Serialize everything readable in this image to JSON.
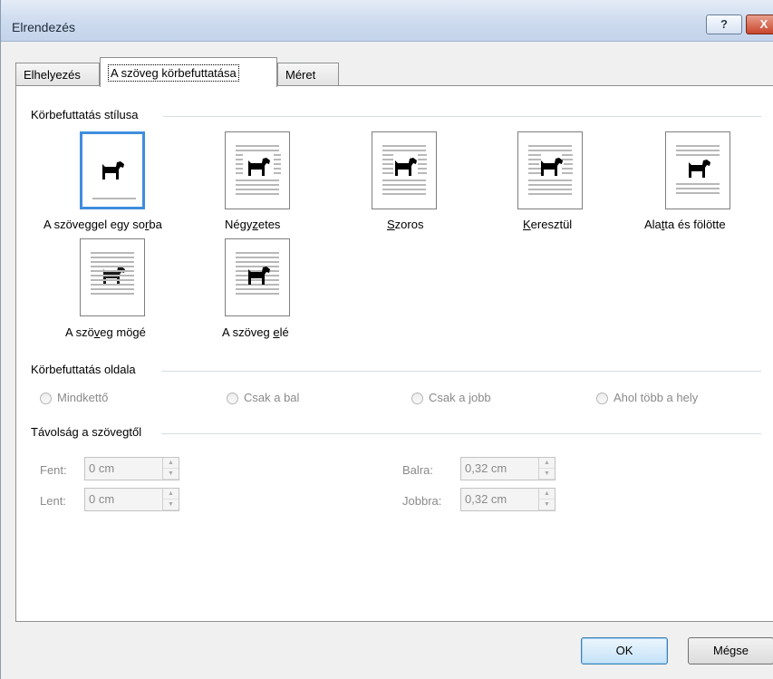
{
  "window": {
    "title": "Elrendezés",
    "help_label": "?",
    "close_label": "X"
  },
  "tabs": [
    {
      "label": "Elhelyezés",
      "active": false
    },
    {
      "label": "A szöveg körbefuttatása",
      "active": true
    },
    {
      "label": "Méret",
      "active": false
    }
  ],
  "wrap_style": {
    "title": "Körbefuttatás stílusa",
    "options": [
      {
        "label_pre": "A szöveggel egy so",
        "label_key": "r",
        "label_post": "ba",
        "icon": "inline-with-text-icon",
        "selected": true
      },
      {
        "label_pre": "Négy",
        "label_key": "z",
        "label_post": "etes",
        "icon": "square-wrap-icon",
        "selected": false
      },
      {
        "label_pre": "",
        "label_key": "S",
        "label_post": "zoros",
        "icon": "tight-wrap-icon",
        "selected": false
      },
      {
        "label_pre": "",
        "label_key": "K",
        "label_post": "eresztül",
        "icon": "through-wrap-icon",
        "selected": false
      },
      {
        "label_pre": "Ala",
        "label_key": "t",
        "label_post": "ta és fölötte",
        "icon": "top-bottom-wrap-icon",
        "selected": false
      },
      {
        "label_pre": "A szö",
        "label_key": "v",
        "label_post": "eg mögé",
        "icon": "behind-text-icon",
        "selected": false
      },
      {
        "label_pre": "A szöveg ",
        "label_key": "e",
        "label_post": "lé",
        "icon": "in-front-of-text-icon",
        "selected": false
      }
    ]
  },
  "wrap_side": {
    "title": "Körbefuttatás oldala",
    "options": [
      "Mindkettő",
      "Csak a bal",
      "Csak a jobb",
      "Ahol több a hely"
    ]
  },
  "distance": {
    "title": "Távolság a szövegtől",
    "top_label": "Fent:",
    "top_value": "0 cm",
    "bottom_label": "Lent:",
    "bottom_value": "0 cm",
    "left_label": "Balra:",
    "left_value": "0,32 cm",
    "right_label": "Jobbra:",
    "right_value": "0,32 cm"
  },
  "buttons": {
    "ok": "OK",
    "cancel": "Mégse"
  },
  "colors": {
    "selection_border": "#3e8ede",
    "ok_button": "#c5e2f8"
  }
}
